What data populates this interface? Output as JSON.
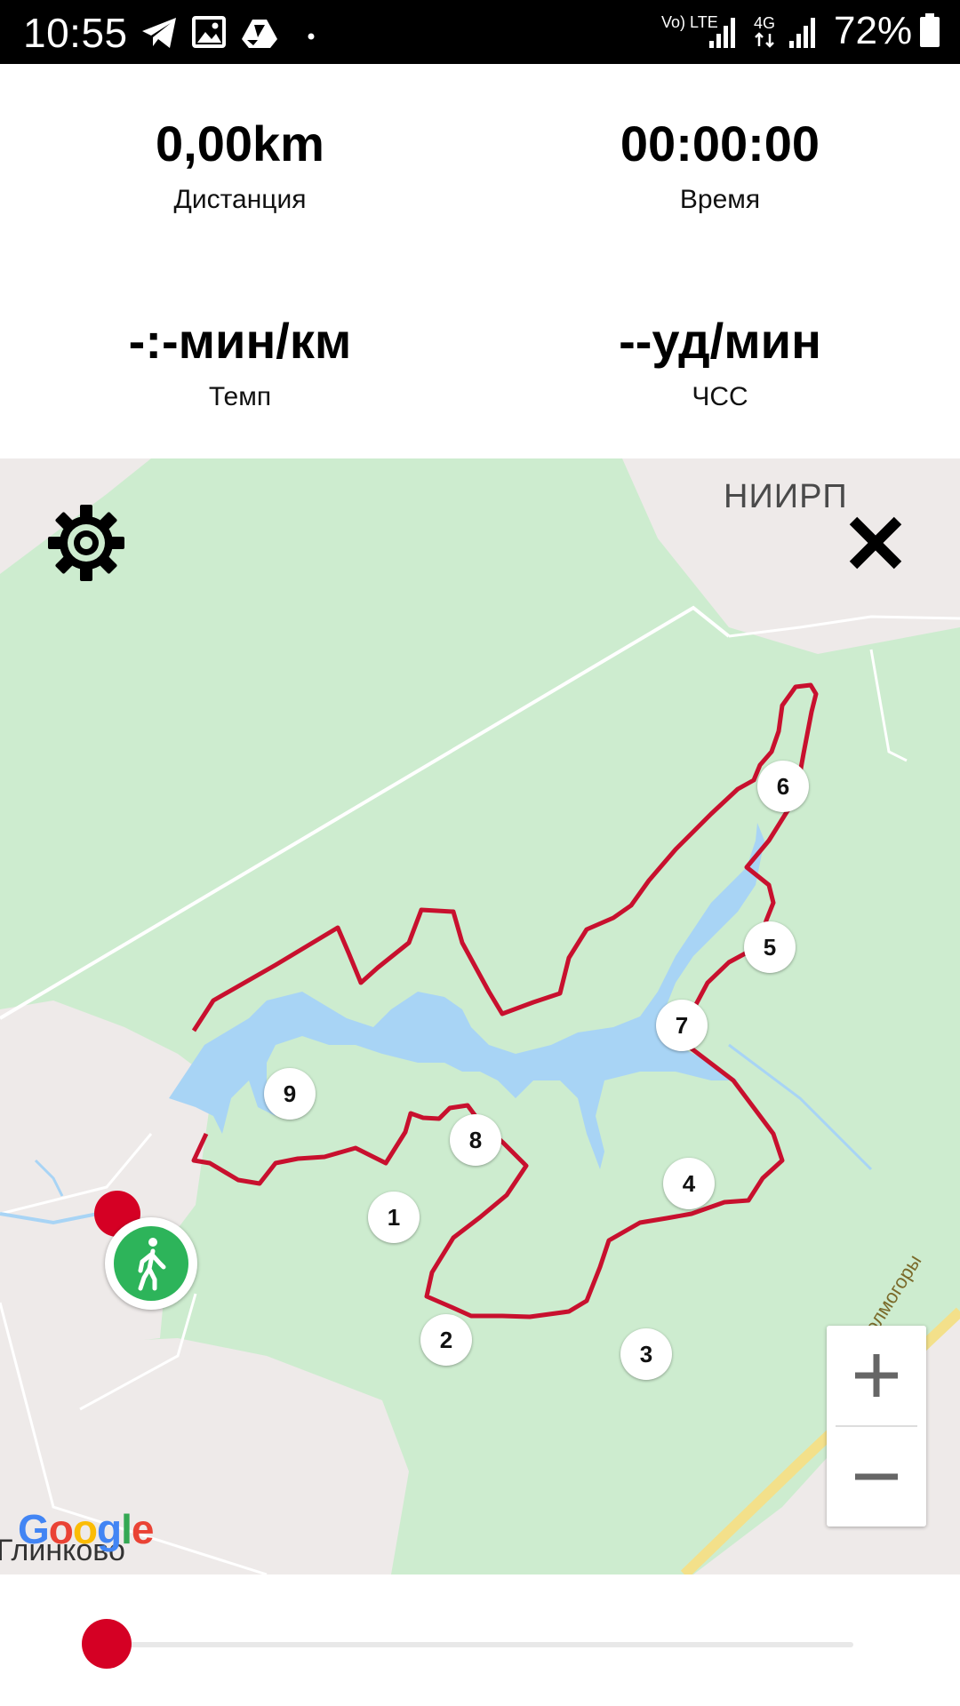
{
  "status_bar": {
    "time": "10:55",
    "network_label_1": "Vo) LTE",
    "network_label_2": "4G",
    "battery_percent": "72%",
    "icons": [
      "telegram-icon",
      "gallery-icon",
      "drive-icon",
      "dot-icon",
      "signal-icon",
      "signal-icon",
      "battery-icon"
    ]
  },
  "stats": {
    "distance": {
      "value": "0,00km",
      "label": "Дистанция"
    },
    "time": {
      "value": "00:00:00",
      "label": "Время"
    },
    "pace": {
      "value": "-:-мин/км",
      "label": "Темп"
    },
    "heart_rate": {
      "value": "--уд/мин",
      "label": "ЧСС"
    }
  },
  "map": {
    "place_niirp": "НИИРП",
    "place_glinkovo": "Глинково",
    "road_label": "а/д Холмогоры",
    "google_logo": "Google",
    "zoom_in": "+",
    "zoom_out": "−",
    "waypoints": [
      "1",
      "2",
      "3",
      "4",
      "5",
      "6",
      "7",
      "8",
      "9"
    ],
    "route_color": "#c8102e",
    "water_color": "#a8d4f5",
    "forest_color": "#cdeccf",
    "icons": [
      "gear-icon",
      "close-icon",
      "walker-icon"
    ]
  },
  "slider": {
    "progress": 0
  },
  "colors": {
    "accent": "#d50024",
    "start_marker": "#2db45a"
  }
}
